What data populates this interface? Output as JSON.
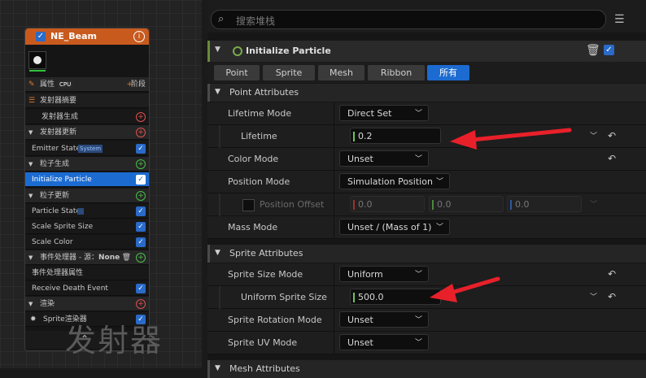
{
  "emitter": {
    "title": "NE_Beam",
    "properties_label": "属性",
    "cpu_label": "CPU",
    "stage_label": "阶段",
    "rows": [
      {
        "label": "发射器摘要"
      },
      {
        "label": "发射器生成"
      },
      {
        "label": "发射器更新"
      },
      {
        "label": "Emitter State",
        "badge": "System"
      },
      {
        "label": "粒子生成"
      },
      {
        "label": "Initialize Particle"
      },
      {
        "label": "粒子更新"
      },
      {
        "label": "Particle State"
      },
      {
        "label": "Scale Sprite Size"
      },
      {
        "label": "Scale Color"
      },
      {
        "label": "事件处理器 - 源：",
        "source": "None"
      },
      {
        "label": "事件处理器属性"
      },
      {
        "label": "Receive Death Event"
      },
      {
        "label": "渲染"
      },
      {
        "label": "Sprite渲染器"
      }
    ],
    "watermark": "发射器"
  },
  "search": {
    "placeholder": "搜索堆栈"
  },
  "module": {
    "title": "Initialize Particle"
  },
  "tabs": [
    "Point",
    "Sprite",
    "Mesh",
    "Ribbon",
    "所有"
  ],
  "point_attributes": {
    "title": "Point Attributes",
    "lifetime_mode": {
      "label": "Lifetime Mode",
      "value": "Direct Set"
    },
    "lifetime": {
      "label": "Lifetime",
      "value": "0.2"
    },
    "color_mode": {
      "label": "Color Mode",
      "value": "Unset"
    },
    "position_mode": {
      "label": "Position Mode",
      "value": "Simulation Position"
    },
    "position_offset": {
      "label": "Position Offset",
      "x": "0.0",
      "y": "0.0",
      "z": "0.0"
    },
    "mass_mode": {
      "label": "Mass Mode",
      "value": "Unset / (Mass of 1)"
    }
  },
  "sprite_attributes": {
    "title": "Sprite Attributes",
    "size_mode": {
      "label": "Sprite Size Mode",
      "value": "Uniform"
    },
    "uniform_size": {
      "label": "Uniform Sprite Size",
      "value": "500.0"
    },
    "rotation_mode": {
      "label": "Sprite Rotation Mode",
      "value": "Unset"
    },
    "uv_mode": {
      "label": "Sprite UV Mode",
      "value": "Unset"
    }
  },
  "mesh_attributes": {
    "title": "Mesh Attributes"
  },
  "colors": {
    "accent": "#1c6bd1",
    "emitter_header": "#c85a1e",
    "arrow": "#e8202a"
  }
}
